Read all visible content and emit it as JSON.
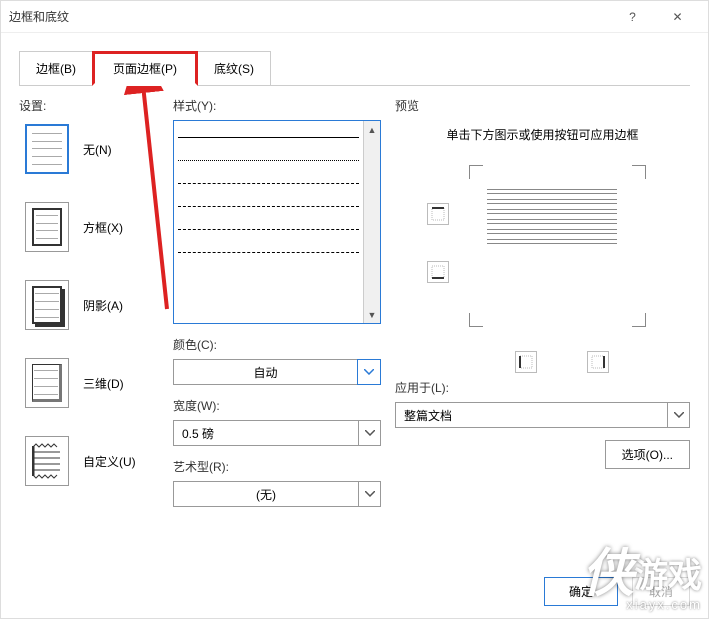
{
  "title": "边框和底纹",
  "tabs": {
    "border": "边框(B)",
    "page_border": "页面边框(P)",
    "shading": "底纹(S)"
  },
  "settings": {
    "label": "设置:",
    "items": [
      {
        "label": "无(N)"
      },
      {
        "label": "方框(X)"
      },
      {
        "label": "阴影(A)"
      },
      {
        "label": "三维(D)"
      },
      {
        "label": "自定义(U)"
      }
    ]
  },
  "style": {
    "label": "样式(Y):"
  },
  "color": {
    "label": "颜色(C):",
    "value": "自动"
  },
  "width": {
    "label": "宽度(W):",
    "value": "0.5 磅"
  },
  "art": {
    "label": "艺术型(R):",
    "value": "(无)"
  },
  "preview": {
    "label": "预览",
    "hint": "单击下方图示或使用按钮可应用边框"
  },
  "apply_to": {
    "label": "应用于(L):",
    "value": "整篇文档"
  },
  "options_btn": "选项(O)...",
  "ok_btn": "确定",
  "cancel_btn": "取消",
  "watermark": {
    "char": "侠",
    "game": "游戏",
    "url": "xiayx.com"
  }
}
